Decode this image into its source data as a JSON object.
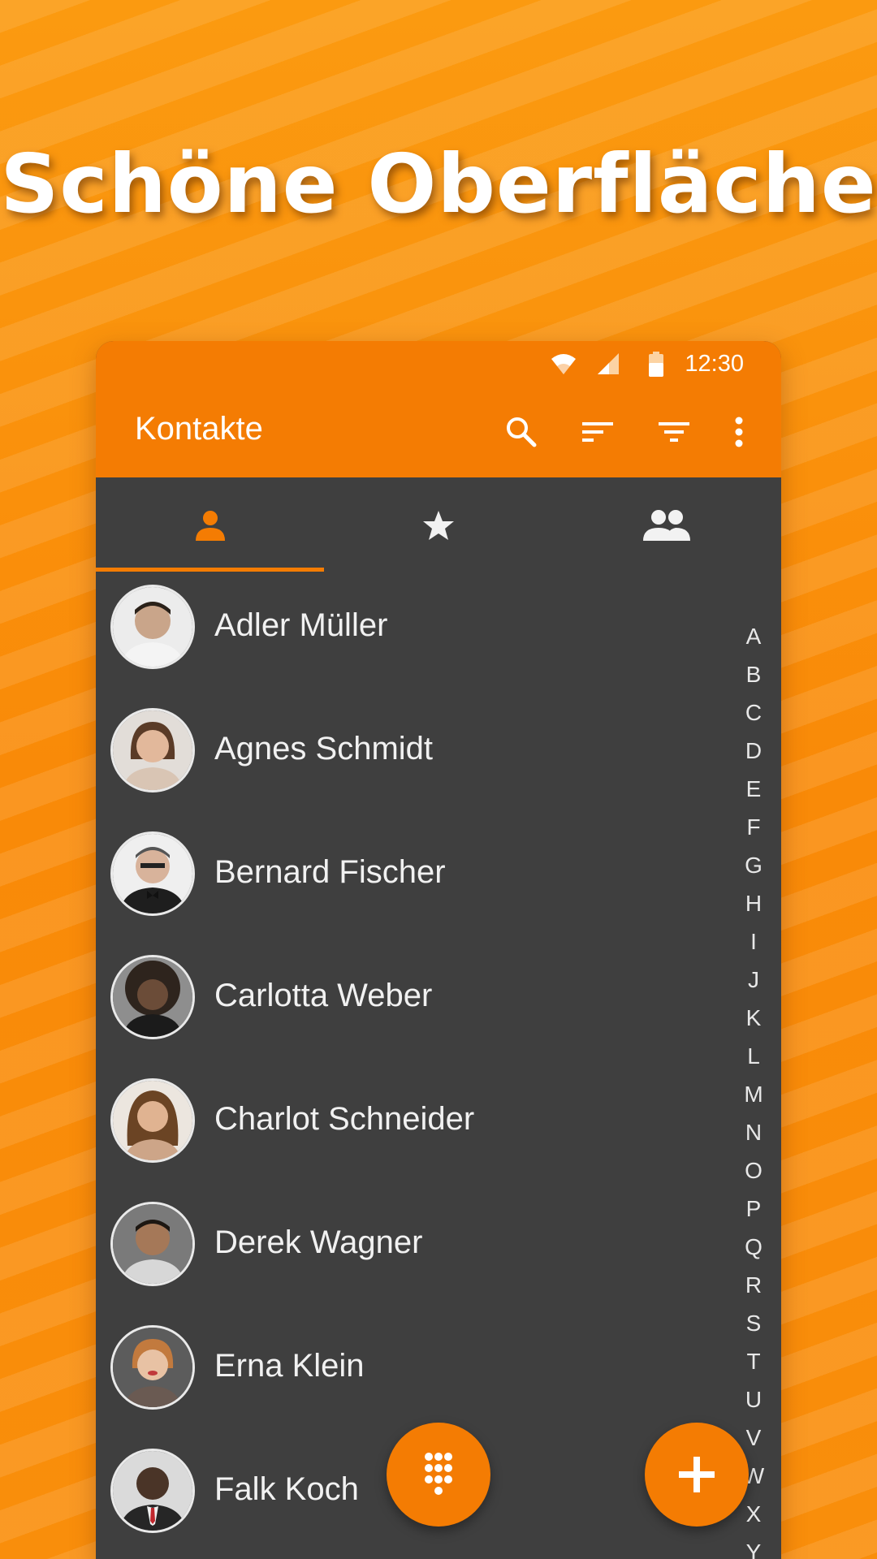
{
  "headline": "Schöne Oberfläche",
  "status_bar": {
    "time": "12:30",
    "icons": [
      "wifi-icon",
      "signal-icon",
      "battery-icon"
    ]
  },
  "app_bar": {
    "title": "Kontakte",
    "actions": [
      "search-icon",
      "sort-icon",
      "filter-icon",
      "more-vert-icon"
    ]
  },
  "tabs": [
    {
      "icon": "person-icon",
      "selected": true
    },
    {
      "icon": "star-icon",
      "selected": false
    },
    {
      "icon": "group-icon",
      "selected": false
    }
  ],
  "contacts": [
    {
      "name": "Adler Müller",
      "avatar_color": "#c9b6a6"
    },
    {
      "name": "Agnes Schmidt",
      "avatar_color": "#d9b49a"
    },
    {
      "name": "Bernard Fischer",
      "avatar_color": "#d6d6d6"
    },
    {
      "name": "Carlotta Weber",
      "avatar_color": "#6b5344"
    },
    {
      "name": "Charlot Schneider",
      "avatar_color": "#c8a38a"
    },
    {
      "name": "Derek Wagner",
      "avatar_color": "#9a7a63"
    },
    {
      "name": "Erna Klein",
      "avatar_color": "#c4a48a"
    },
    {
      "name": "Falk Koch",
      "avatar_color": "#5e4a3e"
    }
  ],
  "alphabet": [
    "A",
    "B",
    "C",
    "D",
    "E",
    "F",
    "G",
    "H",
    "I",
    "J",
    "K",
    "L",
    "M",
    "N",
    "O",
    "P",
    "Q",
    "R",
    "S",
    "T",
    "U",
    "V",
    "W",
    "X",
    "Y"
  ],
  "fabs": [
    "dialpad-icon",
    "add-icon"
  ],
  "colors": {
    "accent": "#f47c03",
    "background": "#3f3f3f",
    "text": "#f1f1f1"
  }
}
